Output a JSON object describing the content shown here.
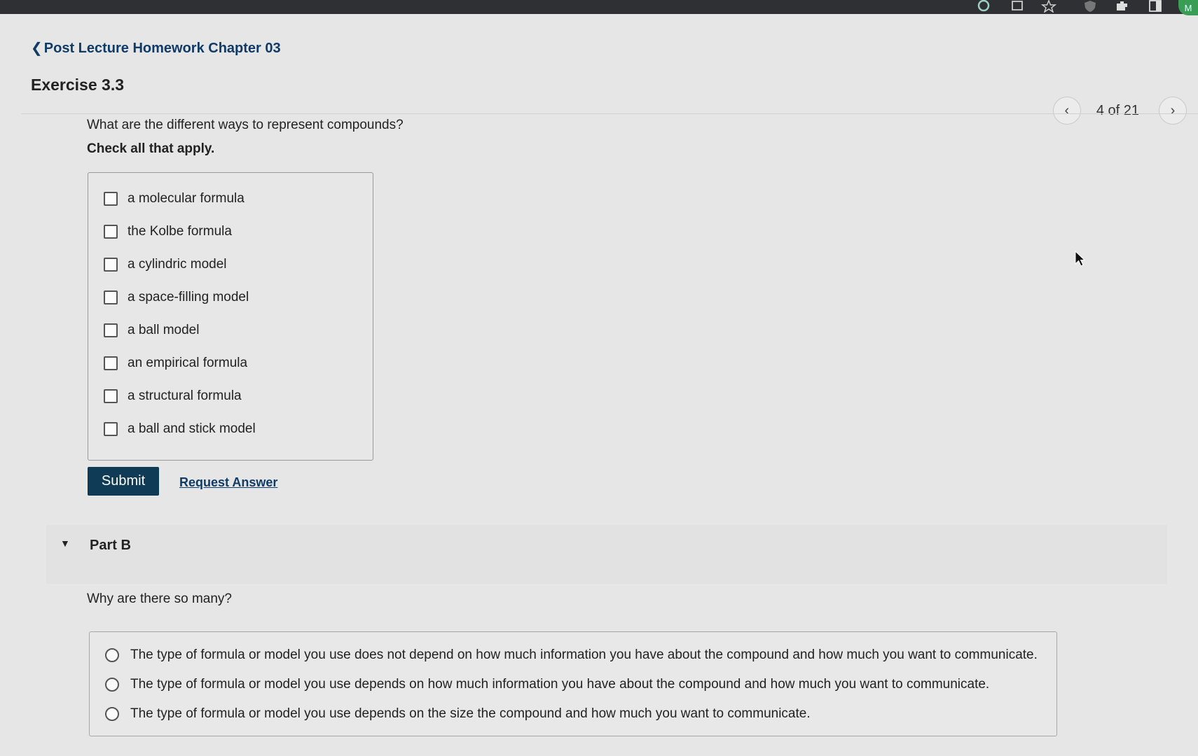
{
  "browser": {
    "avatar_letter": "M",
    "icons": [
      "extension-g-icon",
      "tab-icon",
      "star-icon",
      "shield-icon",
      "puzzle-icon",
      "sidebar-icon"
    ]
  },
  "header": {
    "back_label": "Post Lecture Homework Chapter 03",
    "exercise_title": "Exercise 3.3"
  },
  "pager": {
    "count_label": "4 of 21"
  },
  "part_a": {
    "question": "What are the different ways to represent compounds?",
    "instructions": "Check all that apply.",
    "options": [
      "a molecular formula",
      "the Kolbe formula",
      "a cylindric model",
      "a space-filling model",
      "a ball model",
      "an empirical formula",
      "a structural formula",
      "a ball and stick model"
    ],
    "submit_label": "Submit",
    "request_label": "Request Answer"
  },
  "part_b": {
    "title": "Part B",
    "question": "Why are there so many?",
    "options": [
      "The type of formula or model you use does not depend on how much information you have about the compound and how much you want to communicate.",
      "The type of formula or model you use depends on how much information you have about the compound and how much you want to communicate.",
      "The type of formula or model you use depends on the size the compound and how much you want to communicate."
    ]
  },
  "colors": {
    "accent": "#103b56",
    "link": "#103b66",
    "page_bg": "#e6e6e6"
  }
}
